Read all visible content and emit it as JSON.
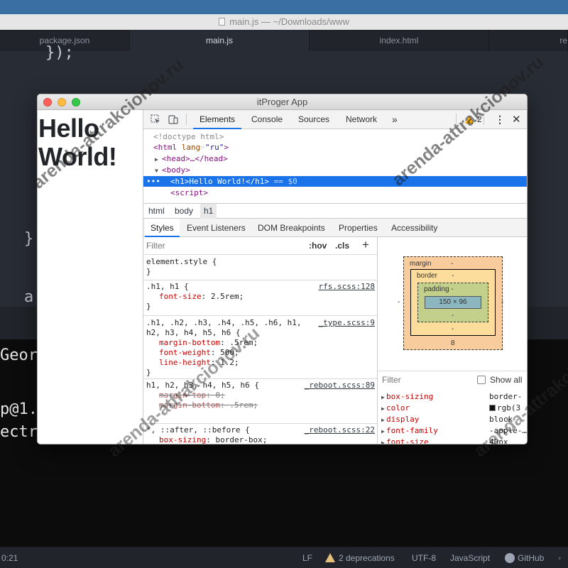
{
  "editor": {
    "window_title": "main.js — ~/Downloads/www",
    "tabs": [
      {
        "label": "package.json"
      },
      {
        "label": "main.js"
      },
      {
        "label": "index.html"
      },
      {
        "label": "re"
      }
    ],
    "code_lines": [
      "});",
      "}",
      "a"
    ],
    "terminal_lines": [
      "Geor",
      "",
      "p@1.",
      "ectr"
    ]
  },
  "status_bar": {
    "time": "0:21",
    "line_ending": "LF",
    "deprecations": "2 deprecations",
    "encoding": "UTF-8",
    "grammar": "JavaScript",
    "github": "GitHub"
  },
  "app": {
    "title": "itProger App",
    "heading_line1": "Hello",
    "heading_line2": "World!"
  },
  "devtools": {
    "tabs": [
      "Elements",
      "Console",
      "Sources",
      "Network"
    ],
    "more_tabs": "»",
    "warning_count": "2",
    "dom": {
      "doctype": "<!doctype html>",
      "html_open": "<html",
      "html_lang_name": "lang",
      "html_lang_value": "\"ru\"",
      "html_close_bracket": ">",
      "head": "<head>…</head>",
      "body": "<body>",
      "selected": "<h1>Hello World!</h1>",
      "selected_suffix": "== $0",
      "script": "<script>"
    },
    "breadcrumbs": [
      "html",
      "body",
      "h1"
    ],
    "side_tabs": [
      "Styles",
      "Event Listeners",
      "DOM Breakpoints",
      "Properties",
      "Accessibility"
    ],
    "styles": {
      "filter_placeholder": "Filter",
      "hov": ":hov",
      "cls": ".cls",
      "add": "+",
      "rules": [
        {
          "selector": "element.style {",
          "close": "}"
        },
        {
          "selector": ".h1, h1 {",
          "source": "rfs.scss:128",
          "decls": [
            {
              "prop": "font-size",
              "value": "2.5rem;"
            }
          ],
          "close": "}"
        },
        {
          "selector_line1": ".h1, .h2, .h3, .h4, .h5, .h6, h1,",
          "selector_line2": "h2, h3, h4, h5, h6 {",
          "source": "_type.scss:9",
          "decls": [
            {
              "prop": "margin-bottom",
              "value": ".5rem;"
            },
            {
              "prop": "font-weight",
              "value": "500;"
            },
            {
              "prop": "line-height",
              "value": "1.2;"
            }
          ],
          "close": "}"
        },
        {
          "selector": "h1, h2, h3, h4, h5, h6 {",
          "source": "_reboot.scss:89",
          "decls": [
            {
              "prop": "margin-top",
              "value": "0;"
            },
            {
              "prop": "margin-bottom",
              "value": ".5rem;"
            }
          ]
        },
        {
          "selector": "*, ::after, ::before {",
          "source": "_reboot.scss:22",
          "decls": [
            {
              "prop": "box-sizing",
              "value": "border-box;"
            }
          ]
        }
      ]
    },
    "box_model": {
      "margin_label": "margin",
      "margin_top": "-",
      "border_label": "border",
      "border_top": "-",
      "padding_label": "padding -",
      "content": "150 × 96",
      "padding_bottom": "-",
      "border_bottom": "-",
      "margin_bottom": "8",
      "left_dash": "-",
      "right_dash": "-"
    },
    "computed": {
      "filter_placeholder": "Filter",
      "show_all": "Show all",
      "props": [
        {
          "name": "box-sizing",
          "value": "border-"
        },
        {
          "name": "color",
          "value": "rgb(3"
        },
        {
          "name": "display",
          "value": "block"
        },
        {
          "name": "font-family",
          "value": "-apple-…"
        },
        {
          "name": "font-size",
          "value": "40px"
        }
      ]
    }
  },
  "watermark": "arenda-attrakcionov.ru",
  "colors": {
    "devtools_accent": "#1a73e8",
    "traffic_close": "#fc605b",
    "traffic_min": "#fdbc40",
    "traffic_max": "#34c84a"
  }
}
